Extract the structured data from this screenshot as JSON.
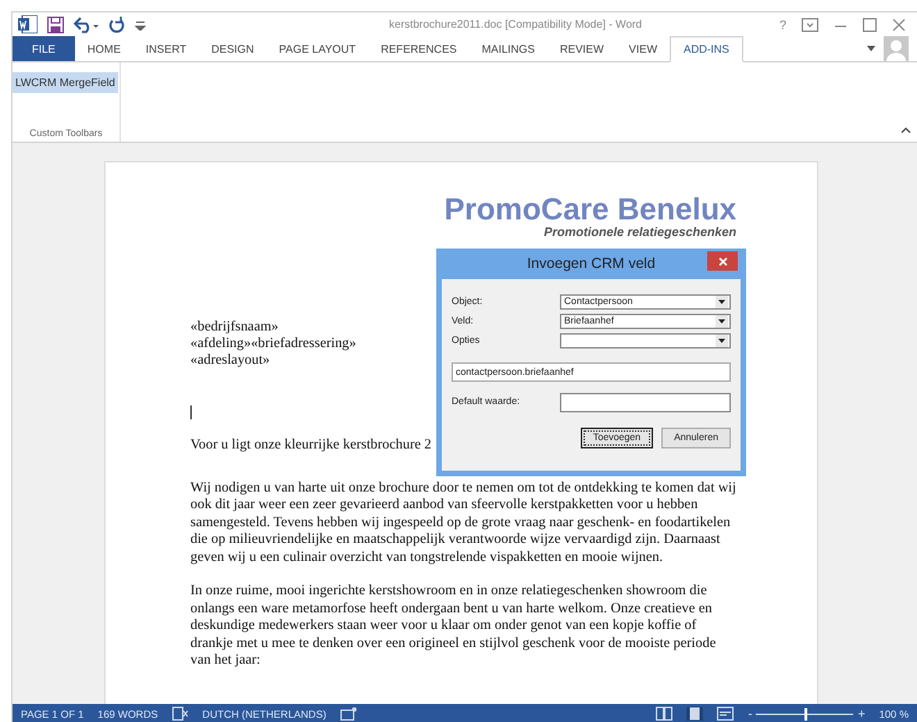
{
  "window": {
    "title": "kerstbrochure2011.doc [Compatibility Mode] - Word",
    "help": "?"
  },
  "tabs": [
    {
      "label": "FILE",
      "kind": "file",
      "selected": false
    },
    {
      "label": "HOME",
      "kind": "tab",
      "selected": false
    },
    {
      "label": "INSERT",
      "kind": "tab",
      "selected": false
    },
    {
      "label": "DESIGN",
      "kind": "tab",
      "selected": false
    },
    {
      "label": "PAGE LAYOUT",
      "kind": "tab",
      "selected": false
    },
    {
      "label": "REFERENCES",
      "kind": "tab",
      "selected": false
    },
    {
      "label": "MAILINGS",
      "kind": "tab",
      "selected": false
    },
    {
      "label": "REVIEW",
      "kind": "tab",
      "selected": false
    },
    {
      "label": "VIEW",
      "kind": "tab",
      "selected": false
    },
    {
      "label": "ADD-INS",
      "kind": "tab",
      "selected": true
    }
  ],
  "ribbon": {
    "buttons": [
      {
        "label": "LWCRM MergeField",
        "selected": true
      }
    ],
    "group_label": "Custom Toolbars"
  },
  "document": {
    "logo": {
      "title": "PromoCare Benelux",
      "tagline": "Promotionele relatiegeschenken"
    },
    "address_fields": [
      "«bedrijfsnaam»",
      "«afdeling»«briefadressering»",
      "«adreslayout»"
    ],
    "intro": "Voor u ligt onze kleurrijke kerstbrochure 2",
    "paragraphs": [
      "Wij nodigen u van harte uit onze brochure door te nemen om tot de ontdekking te komen dat wij ook dit jaar weer een zeer gevarieerd aanbod van sfeervolle kerstpakketten voor u hebben samengesteld. Tevens hebben wij ingespeeld op de grote vraag naar geschenk- en foodartikelen die op milieuvriendelijke en maatschappelijk verantwoorde wijze vervaardigd zijn. Daarnaast geven wij u een culinair overzicht van tongstrelende vispakketten en mooie wijnen.",
      "In onze ruime, mooi ingerichte kerstshowroom en in onze relatiegeschenken showroom die onlangs een ware metamorfose heeft ondergaan bent u van harte welkom. Onze creatieve en deskundige medewerkers staan weer voor u klaar om onder genot van een kopje koffie of drankje met u mee te denken over een origineel en stijlvol geschenk voor de mooiste periode van het jaar:"
    ]
  },
  "dialog": {
    "title": "Invoegen CRM veld",
    "fields": [
      {
        "label": "Object:",
        "value": "Contactpersoon"
      },
      {
        "label": "Veld:",
        "value": "Briefaanhef"
      },
      {
        "label": "Opties"
      }
    ],
    "expression": "contactpersoon.briefaanhef",
    "default_label": "Default waarde:",
    "buttons": [
      {
        "label": "Toevoegen",
        "focused": true
      },
      {
        "label": "Annuleren",
        "focused": false
      }
    ]
  },
  "status_bar": {
    "page": "PAGE 1 OF 1",
    "words": "169 WORDS",
    "language": "DUTCH (NETHERLANDS)",
    "zoom": {
      "zoom_out": "-",
      "zoom_in": "+",
      "level": 0.5,
      "reading": "100 %"
    }
  }
}
